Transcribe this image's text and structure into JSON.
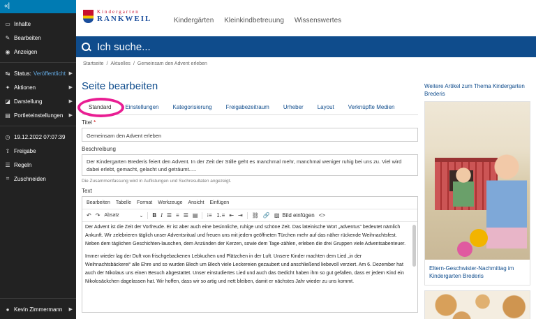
{
  "toolbar": {
    "collapse_icon": "«|",
    "items": [
      {
        "icon": "content-icon",
        "glyph": "▭",
        "label": "Inhalte",
        "has_arrow": false
      },
      {
        "icon": "pencil-icon",
        "glyph": "✎",
        "label": "Bearbeiten",
        "has_arrow": false
      },
      {
        "icon": "eye-icon",
        "glyph": "◉",
        "label": "Anzeigen",
        "has_arrow": false
      }
    ],
    "status": {
      "icon": "status-icon",
      "glyph": "↹",
      "label": "Status:",
      "value": "Veröffentlicht"
    },
    "menus": [
      {
        "icon": "bolt-icon",
        "glyph": "✦",
        "label": "Aktionen"
      },
      {
        "icon": "layout-icon",
        "glyph": "◪",
        "label": "Darstellung"
      },
      {
        "icon": "portlet-icon",
        "glyph": "▤",
        "label": "Portleteinstellungen"
      }
    ],
    "date": {
      "icon": "clock-icon",
      "glyph": "◷",
      "label": "19.12.2022 07:07:39"
    },
    "share": {
      "icon": "share-icon",
      "glyph": "⇪",
      "label": "Freigabe"
    },
    "rules": {
      "icon": "rules-icon",
      "glyph": "☰",
      "label": "Regeln"
    },
    "crop": {
      "icon": "crop-icon",
      "glyph": "⌗",
      "label": "Zuschneiden"
    },
    "user": {
      "icon": "user-icon",
      "glyph": "●",
      "label": "Kevin Zimmermann"
    }
  },
  "header": {
    "logo_top": "Kindergarten",
    "logo_bottom": "RANKWEIL",
    "nav": [
      "Kindergärten",
      "Kleinkindbetreuung",
      "Wissenswertes"
    ]
  },
  "search": {
    "placeholder": "Ich suche..."
  },
  "breadcrumb": [
    "Startseite",
    "/",
    "Aktuelles",
    "/",
    "Gemeinsam den Advent erleben"
  ],
  "edit": {
    "page_title": "Seite bearbeiten",
    "tabs": [
      "Standard",
      "Einstellungen",
      "Kategorisierung",
      "Freigabezeitraum",
      "Urheber",
      "Layout",
      "Verknüpfte Medien"
    ],
    "active_tab": "Standard",
    "title_label": "Titel",
    "title_required": "*",
    "title_value": "Gemeinsam den Advent erleben",
    "description_label": "Beschreibung",
    "description_value": "Der Kindergarten Brederis feiert den Advent. In der Zeit der Stille geht es manchmal mehr, manchmal weniger ruhig bei uns zu. Viel wird dabei erlebt, gemacht, gelacht und geträumt.....",
    "description_help": "Die Zusammenfassung wird in Auflistungen und Suchresultaten angezeigt.",
    "text_label": "Text",
    "editor_menu": [
      "Bearbeiten",
      "Tabelle",
      "Format",
      "Werkzeuge",
      "Ansicht",
      "Einfügen"
    ],
    "format_select": "Absatz",
    "insert_image_label": "Bild einfügen",
    "body_paragraphs": [
      "Der Advent ist die Zeit der Vorfreude. Er ist aber auch eine besinnliche, ruhige und schöne Zeit. Das lateinische Wort „adventus“ bedeutet nämlich Ankunft. Wir zelebrieren täglich unser Adventsritual und freuen uns mit jedem geöffneten Türchen mehr auf das näher rückende Weihnachtsfest. Neben dem täglichen Geschichten-lauschen, dem Anzünden der Kerzen, sowie dem Tage-zählen, erleben die drei Gruppen viele Adventsabenteuer.",
      "Immer wieder lag der Duft von frischgebackenen Lebkuchen und Plätzchen in der Luft. Unsere Kinder machten dem Lied „in der Weihnachtsbäckerei“ alle Ehre und so wurden Blech um Blech viele Leckereien gezaubert und anschließend liebevoll verziert. Am 6. Dezember hat auch der Nikolaus uns einen Besuch abgestattet. Unser einstudiertes Lied und auch das Gedicht haben ihm so gut gefallen, dass er jedem Kind ein Nikolosäckchen dagelassen hat. Wir hoffen, dass wir so artig und nett bleiben, damit er nächstes Jahr wieder zu uns kommt."
    ]
  },
  "related": {
    "heading": "Weitere Artikel zum Thema Kindergarten Brederis",
    "card1_caption": "Eltern-Geschwister-Nachmittag im Kindergarten Brederis"
  },
  "colors": {
    "brand_blue": "#0f4c8c",
    "highlight_circle": "#e91e93",
    "toolbar_bg": "#222222",
    "toolbar_accent": "#007bb3"
  }
}
